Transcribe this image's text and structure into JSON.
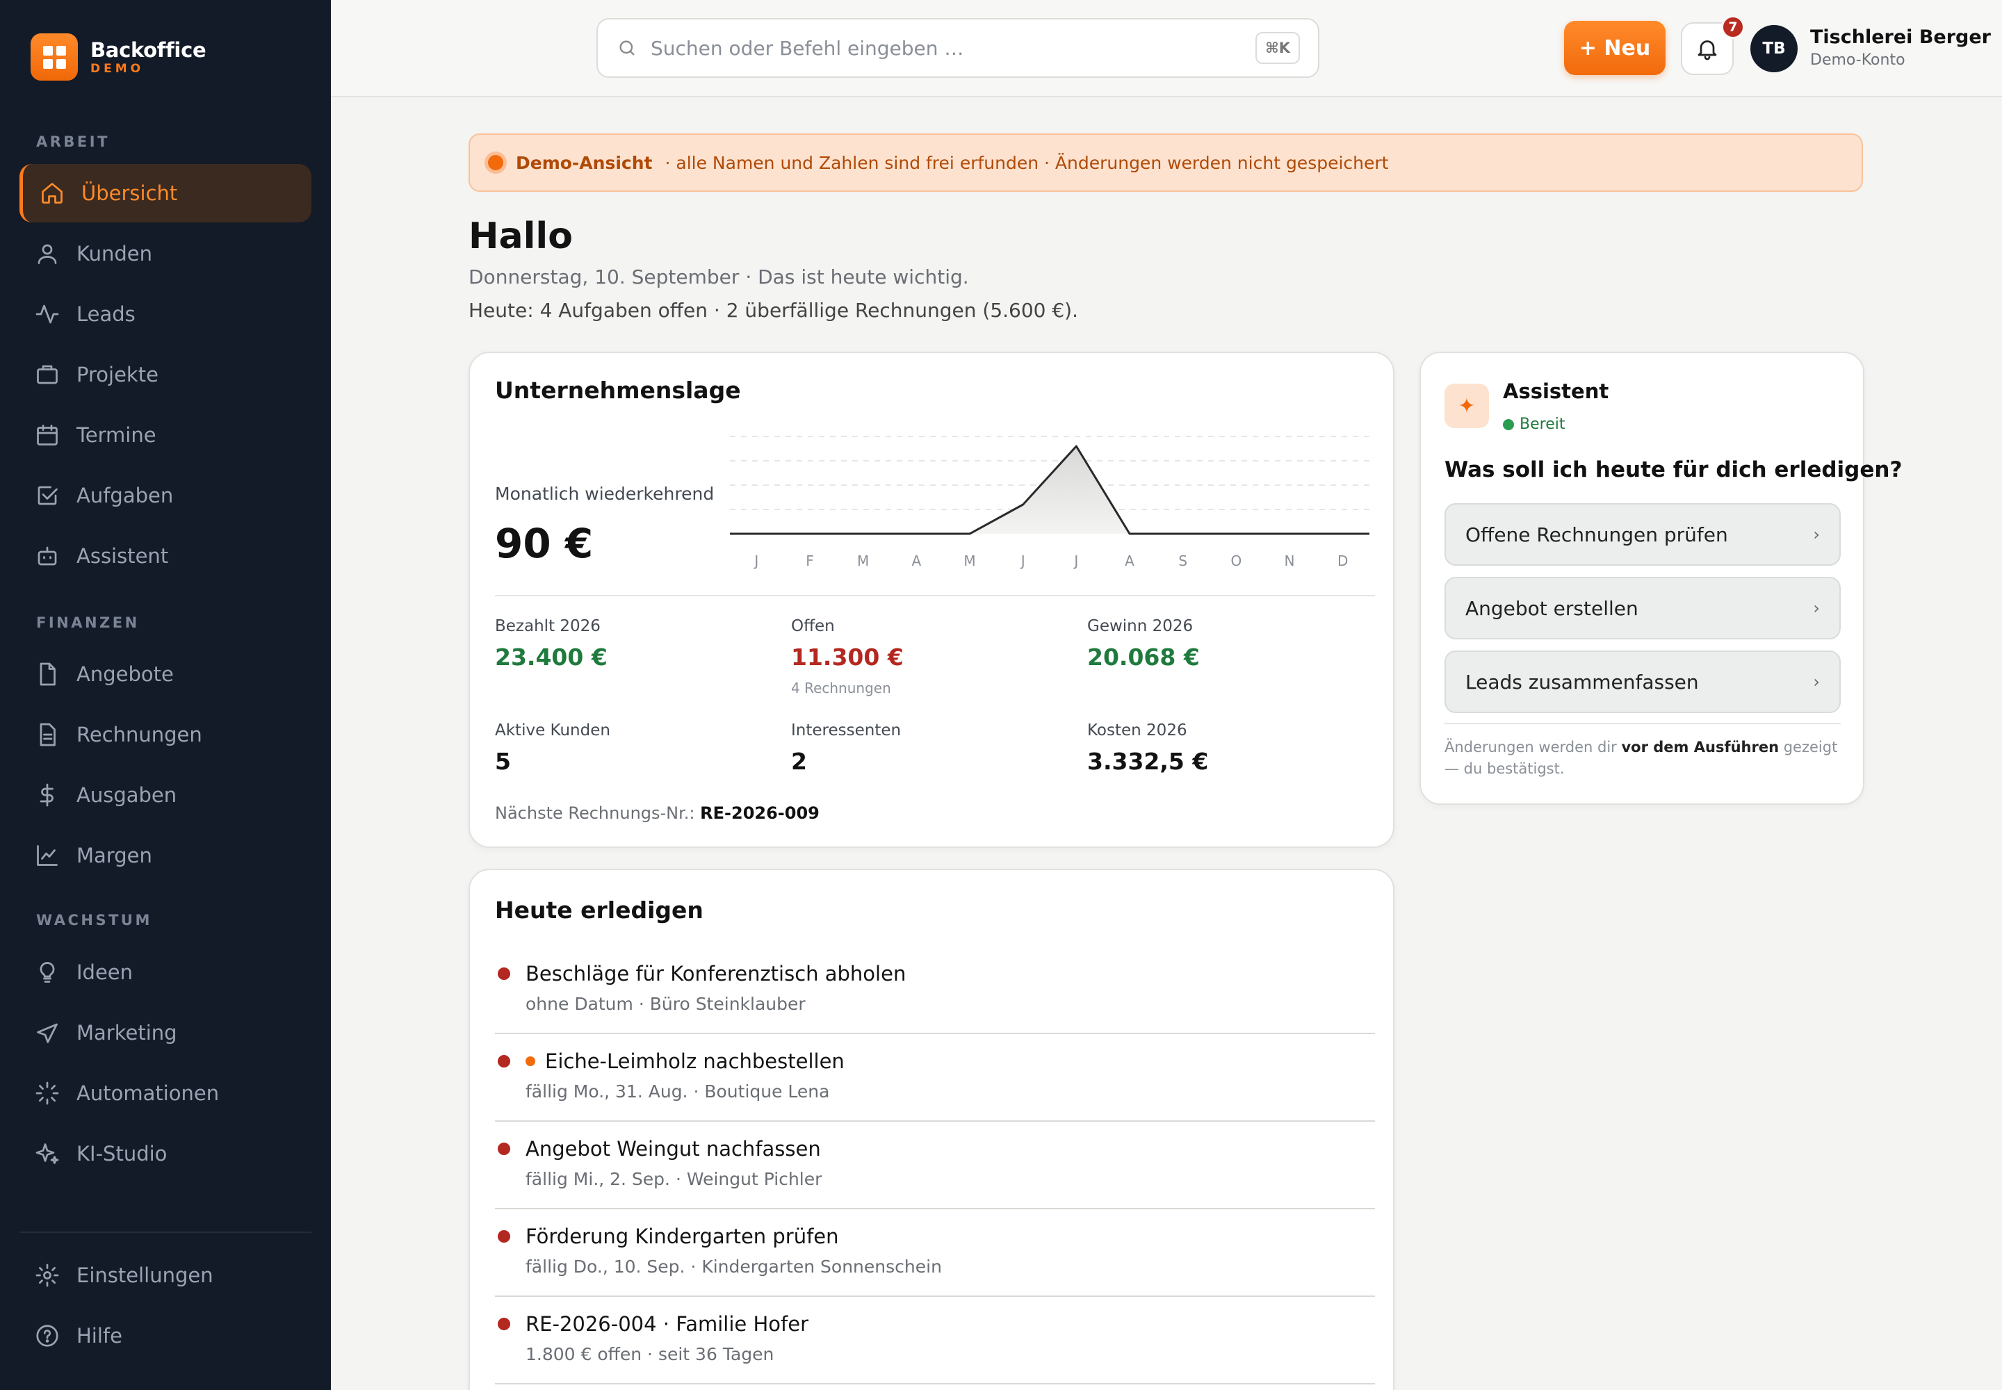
{
  "brand": {
    "name": "Backoffice",
    "sub": "DEMO",
    "accent": "#f26a0c"
  },
  "sidebar": {
    "sections": [
      "ARBEIT",
      "FINANZEN",
      "WACHSTUM"
    ],
    "items": [
      {
        "label": "Übersicht",
        "icon": "home-icon"
      },
      {
        "label": "Kunden",
        "icon": "user-icon"
      },
      {
        "label": "Leads",
        "icon": "activity-icon"
      },
      {
        "label": "Projekte",
        "icon": "briefcase-icon"
      },
      {
        "label": "Termine",
        "icon": "calendar-icon"
      },
      {
        "label": "Aufgaben",
        "icon": "checkbox-icon"
      },
      {
        "label": "Assistent",
        "icon": "bot-icon"
      },
      {
        "label": "Angebote",
        "icon": "file-icon"
      },
      {
        "label": "Rechnungen",
        "icon": "document-icon"
      },
      {
        "label": "Ausgaben",
        "icon": "dollar-icon"
      },
      {
        "label": "Margen",
        "icon": "chart-line-icon"
      },
      {
        "label": "Ideen",
        "icon": "lightbulb-icon"
      },
      {
        "label": "Marketing",
        "icon": "send-icon"
      },
      {
        "label": "Automationen",
        "icon": "loader-icon"
      },
      {
        "label": "KI-Studio",
        "icon": "sparkles-icon"
      }
    ],
    "footer": [
      {
        "label": "Einstellungen",
        "icon": "gear-icon"
      },
      {
        "label": "Hilfe",
        "icon": "help-icon"
      }
    ]
  },
  "header": {
    "search_placeholder": "Suchen oder Befehl eingeben …",
    "shortcut": "⌘K",
    "new_button": "+ Neu",
    "notification_count": "7",
    "avatar_initials": "TB",
    "account_name": "Tischlerei Berger",
    "account_sub": "Demo-Konto"
  },
  "banner": {
    "strong": "Demo-Ansicht",
    "text": "· alle Namen und Zahlen sind frei erfunden · Änderungen werden nicht gespeichert"
  },
  "greeting": {
    "title": "Hallo",
    "subtitle": "Donnerstag, 10. September · Das ist heute wichtig.",
    "summary": "Heute: 4 Aufgaben offen · 2 überfällige Rechnungen (5.600 €)."
  },
  "overview": {
    "title": "Unternehmenslage",
    "mrr_label": "Monatlich wiederkehrend",
    "mrr_value": "90 €",
    "kpis": [
      {
        "label": "Bezahlt 2026",
        "value": "23.400 €",
        "tone": "green"
      },
      {
        "label": "Offen",
        "value": "11.300 €",
        "tone": "red",
        "note": "4 Rechnungen"
      },
      {
        "label": "Gewinn 2026",
        "value": "20.068 €",
        "tone": "green"
      },
      {
        "label": "Aktive Kunden",
        "value": "5",
        "tone": "dark"
      },
      {
        "label": "Interessenten",
        "value": "2",
        "tone": "dark"
      },
      {
        "label": "Kosten 2026",
        "value": "3.332,5 €",
        "tone": "dark"
      }
    ],
    "next_invoice_label": "Nächste Rechnungs-Nr.:",
    "next_invoice_value": "RE-2026-009"
  },
  "chart_data": {
    "type": "area",
    "x": [
      "J",
      "F",
      "M",
      "A",
      "M",
      "J",
      "J",
      "A",
      "S",
      "O",
      "N",
      "D"
    ],
    "values": [
      0,
      0,
      0,
      0,
      0,
      30,
      90,
      0,
      0,
      0,
      0,
      0
    ],
    "ylim": [
      0,
      100
    ],
    "grid": true,
    "title": "",
    "xlabel": "",
    "ylabel": ""
  },
  "assistant": {
    "icon": "sparkle-icon",
    "name": "Assistent",
    "status": "Bereit",
    "question": "Was soll ich heute für dich erledigen?",
    "actions": [
      "Offene Rechnungen prüfen",
      "Angebot erstellen",
      "Leads zusammenfassen"
    ],
    "note_prefix": "Änderungen werden dir ",
    "note_strong": "vor dem Ausführen",
    "note_suffix": " gezeigt — du bestätigst."
  },
  "tasks": {
    "title": "Heute erledigen",
    "items": [
      {
        "title": "Beschläge für Konferenztisch abholen",
        "sub": "ohne Datum · Büro Steinklauber",
        "flag": false
      },
      {
        "title": "Eiche-Leimholz nachbestellen",
        "sub": "fällig Mo., 31. Aug. · Boutique Lena",
        "flag": true
      },
      {
        "title": "Angebot Weingut nachfassen",
        "sub": "fällig Mi., 2. Sep. · Weingut Pichler",
        "flag": false
      },
      {
        "title": "Förderung Kindergarten prüfen",
        "sub": "fällig Do., 10. Sep. · Kindergarten Sonnenschein",
        "flag": false
      },
      {
        "title": "RE-2026-004 · Familie Hofer",
        "sub": "1.800 € offen · seit 36 Tagen",
        "flag": false
      }
    ]
  }
}
